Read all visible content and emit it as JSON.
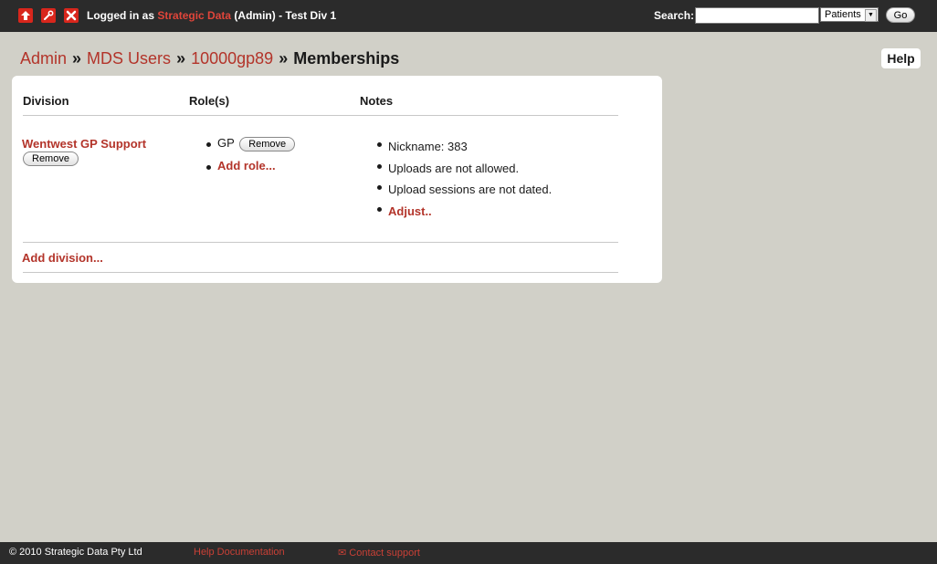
{
  "topbar": {
    "login_prefix": "Logged in as",
    "user": "Strategic Data",
    "login_suffix": "(Admin) - Test Div 1",
    "search_label": "Search:",
    "search_value": "",
    "search_scope": "Patients",
    "go_label": "Go",
    "icons": [
      "home-icon",
      "settings-tool-icon",
      "logout-close-icon"
    ],
    "accent": "#d8261c"
  },
  "breadcrumb": {
    "items": [
      "Admin",
      "MDS Users",
      "10000gp89"
    ],
    "separator": "»",
    "current": "Memberships"
  },
  "help_label": "Help",
  "table": {
    "headers": [
      "Division",
      "Role(s)",
      "Notes"
    ],
    "row": {
      "division": "Wentwest GP Support",
      "division_remove": "Remove",
      "roles": [
        {
          "name": "GP",
          "remove": "Remove"
        }
      ],
      "add_role": "Add role...",
      "notes": [
        "Nickname: 383",
        "Uploads are not allowed.",
        "Upload sessions are not dated."
      ],
      "adjust": "Adjust.."
    },
    "add_division": "Add division..."
  },
  "footer": {
    "copyright": "© 2010 Strategic Data Pty Ltd",
    "help_docs": "Help Documentation",
    "contact": "✉ Contact support"
  }
}
